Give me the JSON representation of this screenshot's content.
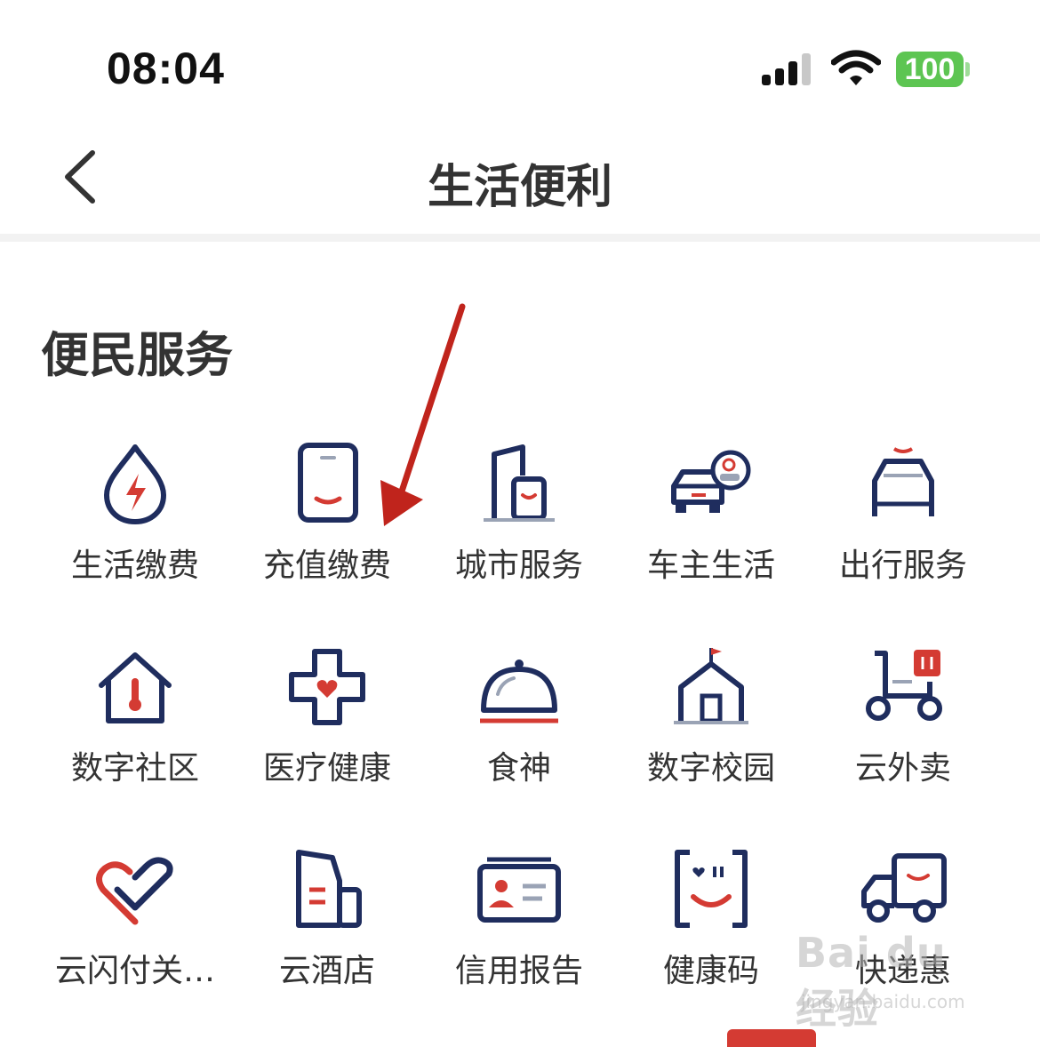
{
  "status_bar": {
    "time": "08:04",
    "battery": "100"
  },
  "nav": {
    "title": "生活便利"
  },
  "section": {
    "title": "便民服务"
  },
  "services": [
    {
      "label": "生活缴费",
      "icon": "water-bolt-icon"
    },
    {
      "label": "充值缴费",
      "icon": "phone-icon"
    },
    {
      "label": "城市服务",
      "icon": "building-icon"
    },
    {
      "label": "车主生活",
      "icon": "car-icon"
    },
    {
      "label": "出行服务",
      "icon": "taxi-icon"
    },
    {
      "label": "数字社区",
      "icon": "house-thermometer-icon"
    },
    {
      "label": "医疗健康",
      "icon": "medical-cross-icon"
    },
    {
      "label": "食神",
      "icon": "food-cloche-icon"
    },
    {
      "label": "数字校园",
      "icon": "school-icon"
    },
    {
      "label": "云外卖",
      "icon": "delivery-scooter-icon"
    },
    {
      "label": "云闪付关…",
      "icon": "heart-check-icon"
    },
    {
      "label": "云酒店",
      "icon": "hotel-icon"
    },
    {
      "label": "信用报告",
      "icon": "id-card-icon"
    },
    {
      "label": "健康码",
      "icon": "scan-face-icon"
    },
    {
      "label": "快递惠",
      "icon": "truck-icon"
    }
  ],
  "watermark": {
    "main": "Bai du 经验",
    "sub": "jingyan.baidu.com"
  },
  "colors": {
    "navy": "#1f2d5e",
    "red": "#d43b33",
    "gray": "#9aa3b5"
  }
}
